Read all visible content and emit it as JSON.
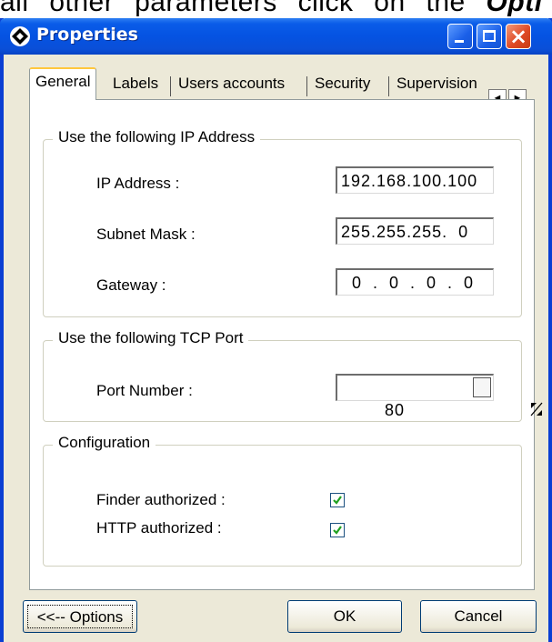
{
  "doc_text": {
    "prefix": "all other parameters click on the",
    "emphasis": "Opti"
  },
  "window": {
    "title": "Properties"
  },
  "tabs": [
    {
      "label": "General",
      "active": true
    },
    {
      "label": "Labels"
    },
    {
      "label": "Users accounts"
    },
    {
      "label": "Security"
    },
    {
      "label": "Supervision"
    }
  ],
  "tab_scroll": {
    "left": "◄",
    "right": "►"
  },
  "ip_group": {
    "legend": "Use the following IP Address",
    "ip_label": "IP Address :",
    "ip_value": "192.168.100.100",
    "subnet_label": "Subnet Mask :",
    "subnet_value": "255.255.255.  0",
    "gateway_label": "Gateway :",
    "gateway_value": "  0  .  0  .  0  .  0"
  },
  "tcp_group": {
    "legend": "Use the following TCP Port",
    "port_label": "Port Number :",
    "port_value": "80"
  },
  "config_group": {
    "legend": "Configuration",
    "finder_label": "Finder authorized :",
    "finder_checked": true,
    "http_label": "HTTP authorized :",
    "http_checked": true
  },
  "buttons": {
    "options": "<<-- Options",
    "ok": "OK",
    "cancel": "Cancel"
  },
  "colors": {
    "titlebar": "#0553e2",
    "dialog_bg": "#ece9d8",
    "check_green": "#21a121"
  }
}
